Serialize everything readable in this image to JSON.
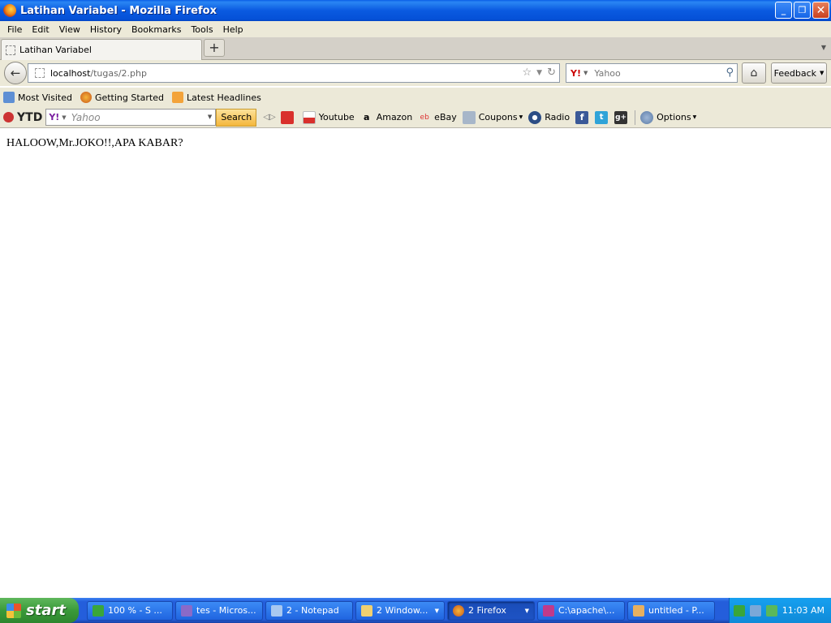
{
  "window": {
    "title": "Latihan Variabel - Mozilla Firefox"
  },
  "menu": [
    "File",
    "Edit",
    "View",
    "History",
    "Bookmarks",
    "Tools",
    "Help"
  ],
  "tab": {
    "title": "Latihan Variabel"
  },
  "url": {
    "host": "localhost",
    "path": "/tugas/2.php"
  },
  "search": {
    "placeholder": "Yahoo"
  },
  "nav": {
    "feedback_label": "Feedback"
  },
  "bookmarks": [
    "Most Visited",
    "Getting Started",
    "Latest Headlines"
  ],
  "ytoolbar": {
    "brand": "YTD",
    "search_placeholder": "Yahoo",
    "search_button": "Search",
    "links": [
      "Youtube",
      "Amazon",
      "eBay",
      "Coupons",
      "Radio"
    ],
    "options_label": "Options"
  },
  "content": {
    "message": "HALOOW,Mr.JOKO!!,APA KABAR?"
  },
  "taskbar": {
    "start_label": "start",
    "tasks": [
      "100 % - S ...",
      "tes - Micros...",
      "2 - Notepad",
      "2 Window...",
      "2 Firefox",
      "C:\\apache\\...",
      "untitled - P..."
    ],
    "clock": "11:03 AM"
  }
}
